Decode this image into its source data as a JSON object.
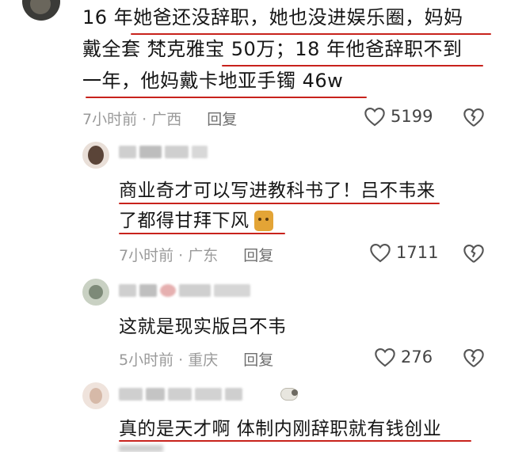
{
  "main_comment": {
    "lines": [
      "16 年她爸还没辞职，她也没进娱乐圈，妈妈",
      "戴全套 梵克雅宝  50万；18 年他爸辞职不到",
      "一年，他妈戴卡地亚手镯 46w"
    ],
    "time_location": "7小时前 · 广西",
    "reply_label": "回复",
    "like_count": "5199"
  },
  "replies": [
    {
      "lines": [
        "商业奇才可以写进教科书了！吕不韦来",
        "了都得甘拜下风"
      ],
      "time_location": "7小时前 · 广东",
      "reply_label": "回复",
      "like_count": "1711"
    },
    {
      "lines": [
        "这就是现实版吕不韦"
      ],
      "time_location": "5小时前 · 重庆",
      "reply_label": "回复",
      "like_count": "276"
    },
    {
      "lines": [
        "真的是天才啊 体制内刚辞职就有钱创业"
      ],
      "time_location": "",
      "reply_label": "",
      "like_count": ""
    }
  ],
  "icons": [
    "heart-icon",
    "dislike-heart-icon",
    "emoji-sticker-icon",
    "sheep-icon"
  ],
  "colors": {
    "underline": "#c8221c",
    "meta": "#9a9a9a"
  }
}
